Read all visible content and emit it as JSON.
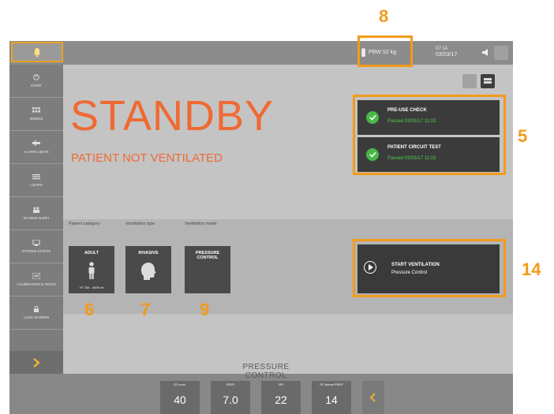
{
  "header": {
    "pbw": "PBW 52 kg",
    "time": "07:14",
    "date": "03/03/17"
  },
  "sidebar": {
    "items": [
      {
        "label": "START",
        "icon": "power-icon"
      },
      {
        "label": "MODES",
        "icon": "modes-icon"
      },
      {
        "label": "ALARM LIMITS",
        "icon": "alarm-limits-icon"
      },
      {
        "label": "LOOPS",
        "icon": "loops-icon"
      },
      {
        "label": "IN-VIEW ALERT",
        "icon": "people-icon"
      },
      {
        "label": "SYSTEM STATUS",
        "icon": "system-icon"
      },
      {
        "label": "CALIBRATION & TESTS",
        "icon": "calibration-icon"
      },
      {
        "label": "LOCK SCREEN",
        "icon": "lock-icon"
      }
    ]
  },
  "main": {
    "title": "STANDBY",
    "subtitle": "PATIENT NOT VENTILATED"
  },
  "checks": [
    {
      "title": "PRE-USE CHECK",
      "status": "Passed 03/03/17 11:03"
    },
    {
      "title": "PATIENT CIRCUIT TEST",
      "status": "Passed 03/03/17 11:03"
    }
  ],
  "categories": {
    "labels": {
      "patient": "Patient category",
      "ventilation_type": "Ventilation type",
      "ventilation_mode": "Ventilation mode"
    },
    "adult": {
      "label": "ADULT",
      "sub": "VT 100 - 4000 ml"
    },
    "invasive": {
      "label": "INVASIVE"
    },
    "mode": {
      "label": "PRESSURE CONTROL"
    }
  },
  "start": {
    "title": "START VENTILATION",
    "subtitle": "Pressure Control"
  },
  "bottom": {
    "mode_title": "PRESSURE CONTROL",
    "params": [
      {
        "label": "O2 conc.",
        "value": "40"
      },
      {
        "label": "PEEP",
        "value": "7.0"
      },
      {
        "label": "RR",
        "value": "22"
      },
      {
        "label": "PC above PEEP",
        "value": "14"
      }
    ]
  },
  "callouts": [
    "8",
    "5",
    "14",
    "6",
    "7",
    "9"
  ],
  "colors": {
    "accent_orange": "#ef6a33",
    "callout_orange": "#f29b1b",
    "pass_green": "#4fd04c"
  }
}
